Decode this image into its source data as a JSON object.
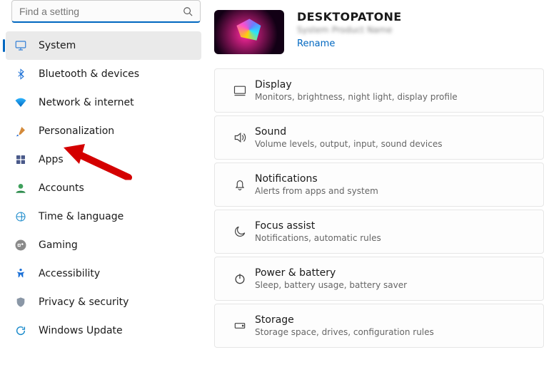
{
  "search": {
    "placeholder": "Find a setting"
  },
  "nav": {
    "items": [
      {
        "id": "system",
        "label": "System"
      },
      {
        "id": "bluetooth",
        "label": "Bluetooth & devices"
      },
      {
        "id": "network",
        "label": "Network & internet"
      },
      {
        "id": "personalization",
        "label": "Personalization"
      },
      {
        "id": "apps",
        "label": "Apps"
      },
      {
        "id": "accounts",
        "label": "Accounts"
      },
      {
        "id": "time",
        "label": "Time & language"
      },
      {
        "id": "gaming",
        "label": "Gaming"
      },
      {
        "id": "accessibility",
        "label": "Accessibility"
      },
      {
        "id": "privacy",
        "label": "Privacy & security"
      },
      {
        "id": "update",
        "label": "Windows Update"
      }
    ]
  },
  "device": {
    "name": "DESKTOPATONE",
    "sub": "System Product Name",
    "rename": "Rename"
  },
  "cards": [
    {
      "id": "display",
      "title": "Display",
      "sub": "Monitors, brightness, night light, display profile"
    },
    {
      "id": "sound",
      "title": "Sound",
      "sub": "Volume levels, output, input, sound devices"
    },
    {
      "id": "notifications",
      "title": "Notifications",
      "sub": "Alerts from apps and system"
    },
    {
      "id": "focus",
      "title": "Focus assist",
      "sub": "Notifications, automatic rules"
    },
    {
      "id": "power",
      "title": "Power & battery",
      "sub": "Sleep, battery usage, battery saver"
    },
    {
      "id": "storage",
      "title": "Storage",
      "sub": "Storage space, drives, configuration rules"
    }
  ]
}
